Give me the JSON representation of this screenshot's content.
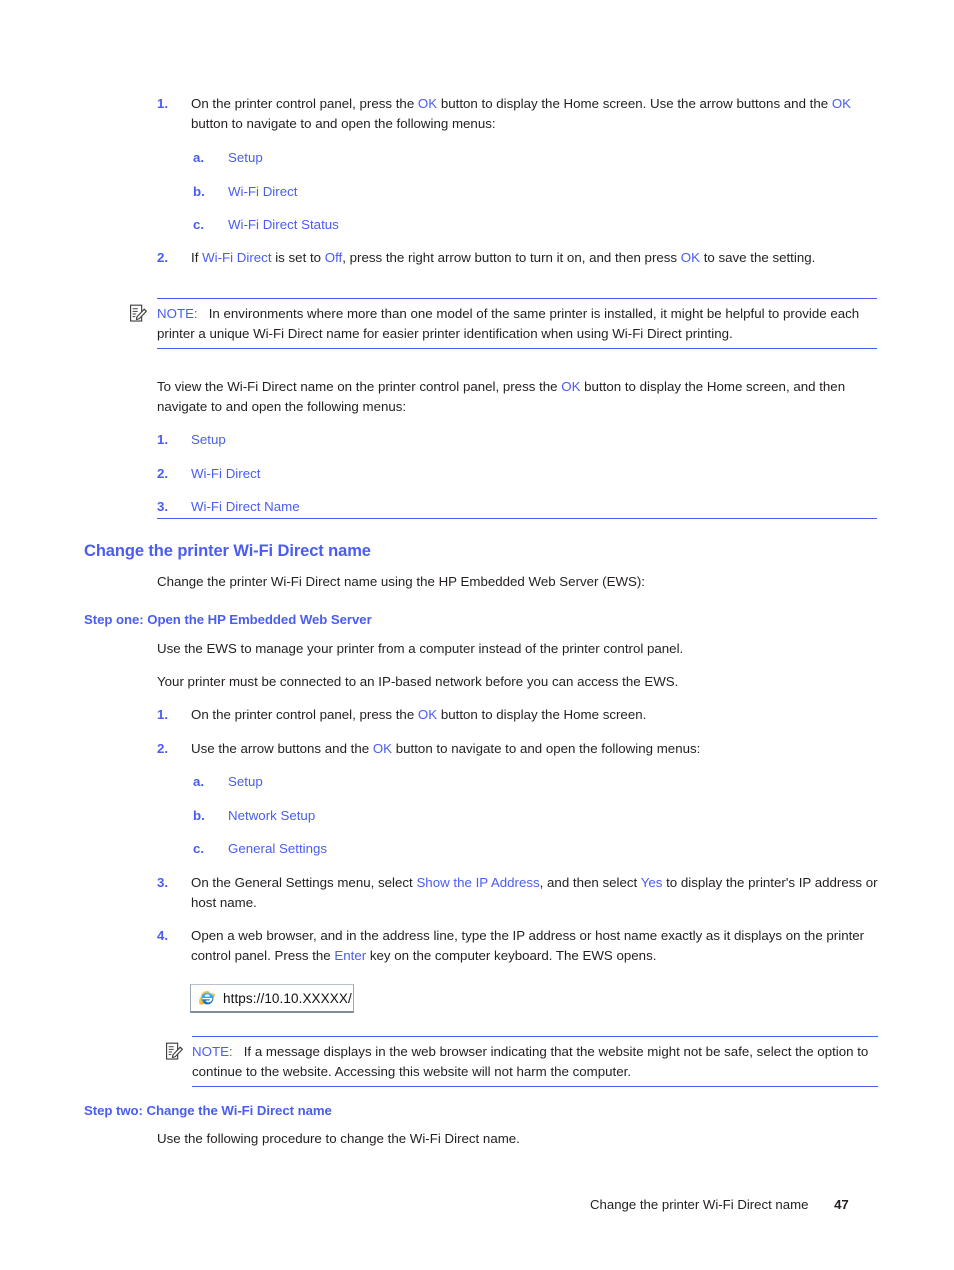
{
  "colors": {
    "link_blue": "#4a5df0",
    "heading_blue": "#4a5df0",
    "body_black": "#231f20",
    "rule_blue": "#4a5df0"
  },
  "section_1": {
    "steps": [
      {
        "marker": "1.",
        "segments": [
          {
            "t": "On the printer control panel, press the ",
            "style": "plain"
          },
          {
            "t": "OK",
            "style": "link"
          },
          {
            "t": " button to display the Home screen. Use the arrow buttons and the ",
            "style": "plain"
          },
          {
            "t": "OK",
            "style": "link"
          },
          {
            "t": " button to navigate to and open the following menus:",
            "style": "plain"
          }
        ],
        "substeps": [
          {
            "marker": "a.",
            "label": "Setup"
          },
          {
            "marker": "b.",
            "label": "Wi-Fi Direct"
          },
          {
            "marker": "c.",
            "label": "Wi-Fi Direct Status"
          }
        ]
      },
      {
        "marker": "2.",
        "segments": [
          {
            "t": "If ",
            "style": "plain"
          },
          {
            "t": "Wi-Fi Direct",
            "style": "link"
          },
          {
            "t": " is set to ",
            "style": "plain"
          },
          {
            "t": "Off",
            "style": "link"
          },
          {
            "t": ", press the right arrow button to turn it on, and then press ",
            "style": "plain"
          },
          {
            "t": "OK",
            "style": "link"
          },
          {
            "t": " to save the setting.",
            "style": "plain"
          }
        ],
        "substeps": []
      }
    ]
  },
  "note_1": {
    "icon": "note-pencil-icon",
    "label": "NOTE:",
    "text": "In environments where more than one model of the same printer is installed, it might be helpful to provide each printer a unique Wi-Fi Direct name for easier printer identification when using Wi-Fi Direct printing."
  },
  "section_2": {
    "intro_segments": [
      {
        "t": "To view the Wi-Fi Direct name on the printer control panel, press the ",
        "style": "plain"
      },
      {
        "t": "OK",
        "style": "link"
      },
      {
        "t": " button to display the Home screen, and then navigate to and open the following menus:",
        "style": "plain"
      }
    ],
    "steps": [
      {
        "marker": "1.",
        "label": "Setup"
      },
      {
        "marker": "2.",
        "label": "Wi-Fi Direct"
      },
      {
        "marker": "3.",
        "label": "Wi-Fi Direct Name"
      }
    ]
  },
  "heading_main": "Change the printer Wi-Fi Direct name",
  "intro_paragraph": "Change the printer Wi-Fi Direct name using the HP Embedded Web Server (EWS):",
  "step_one": {
    "heading": "Step one: Open the HP Embedded Web Server",
    "paragraph_1": "Use the EWS to manage your printer from a computer instead of the printer control panel.",
    "paragraph_2": "Your printer must be connected to an IP-based network before you can access the EWS.",
    "steps": [
      {
        "marker": "1.",
        "segments": [
          {
            "t": "On the printer control panel, press the ",
            "style": "plain"
          },
          {
            "t": "OK",
            "style": "link"
          },
          {
            "t": " button to display the Home screen.",
            "style": "plain"
          }
        ],
        "substeps": []
      },
      {
        "marker": "2.",
        "segments": [
          {
            "t": "Use the arrow buttons and the ",
            "style": "plain"
          },
          {
            "t": "OK",
            "style": "link"
          },
          {
            "t": " button to navigate to and open the following menus:",
            "style": "plain"
          }
        ],
        "substeps": [
          {
            "marker": "a.",
            "label": "Setup"
          },
          {
            "marker": "b.",
            "label": "Network Setup"
          },
          {
            "marker": "c.",
            "label": "General Settings"
          }
        ]
      },
      {
        "marker": "3.",
        "segments": [
          {
            "t": "On the General Settings menu, select ",
            "style": "plain"
          },
          {
            "t": "Show the IP Address",
            "style": "link"
          },
          {
            "t": ", and then select ",
            "style": "plain"
          },
          {
            "t": "Yes",
            "style": "link"
          },
          {
            "t": " to display the printer's IP address or host name.",
            "style": "plain"
          }
        ],
        "substeps": []
      },
      {
        "marker": "4.",
        "segments": [
          {
            "t": "Open a web browser, and in the address line, type the IP address or host name exactly as it displays on the printer control panel. Press the ",
            "style": "plain"
          },
          {
            "t": "Enter",
            "style": "link"
          },
          {
            "t": " key on the computer keyboard. The EWS opens.",
            "style": "plain"
          }
        ],
        "substeps": []
      }
    ],
    "address_bar": {
      "icon": "internet-explorer-icon",
      "url": "https://10.10.XXXXX/"
    }
  },
  "note_2": {
    "icon": "note-pencil-icon",
    "label": "NOTE:",
    "text": "If a message displays in the web browser indicating that the website might not be safe, select the option to continue to the website. Accessing this website will not harm the computer."
  },
  "step_two": {
    "heading": "Step two: Change the Wi-Fi Direct name",
    "paragraph_1": "Use the following procedure to change the Wi-Fi Direct name."
  },
  "footer": {
    "title": "Change the printer Wi-Fi Direct name",
    "page_number": "47"
  }
}
